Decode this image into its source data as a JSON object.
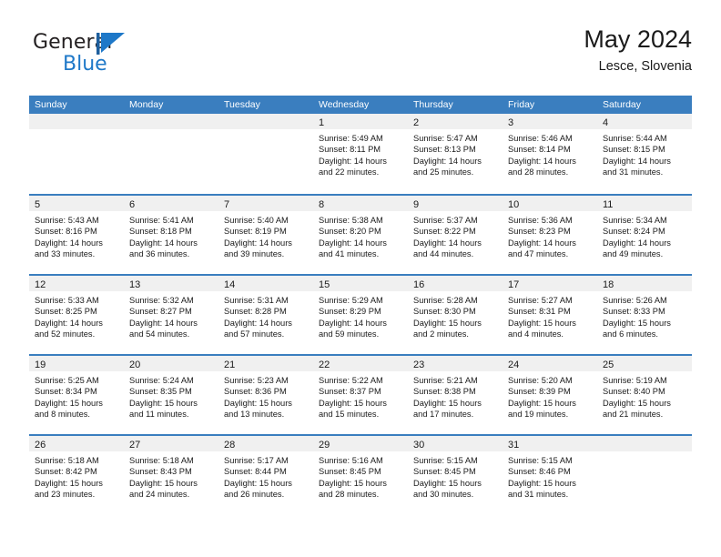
{
  "logo": {
    "word_one": "General",
    "word_two": "Blue",
    "mark": "triangle-pennant-icon",
    "accent_color": "#1e78c8"
  },
  "header": {
    "title": "May 2024",
    "subtitle": "Lesce, Slovenia"
  },
  "calendar": {
    "header_bg": "#3a7ebf",
    "daynum_band_bg": "#f0f0f0",
    "weekday_headers": [
      "Sunday",
      "Monday",
      "Tuesday",
      "Wednesday",
      "Thursday",
      "Friday",
      "Saturday"
    ],
    "weeks": [
      [
        {
          "day": "",
          "empty": true
        },
        {
          "day": "",
          "empty": true
        },
        {
          "day": "",
          "empty": true
        },
        {
          "day": "1",
          "sunrise": "Sunrise: 5:49 AM",
          "sunset": "Sunset: 8:11 PM",
          "daylight_line1": "Daylight: 14 hours",
          "daylight_line2": "and 22 minutes."
        },
        {
          "day": "2",
          "sunrise": "Sunrise: 5:47 AM",
          "sunset": "Sunset: 8:13 PM",
          "daylight_line1": "Daylight: 14 hours",
          "daylight_line2": "and 25 minutes."
        },
        {
          "day": "3",
          "sunrise": "Sunrise: 5:46 AM",
          "sunset": "Sunset: 8:14 PM",
          "daylight_line1": "Daylight: 14 hours",
          "daylight_line2": "and 28 minutes."
        },
        {
          "day": "4",
          "sunrise": "Sunrise: 5:44 AM",
          "sunset": "Sunset: 8:15 PM",
          "daylight_line1": "Daylight: 14 hours",
          "daylight_line2": "and 31 minutes."
        }
      ],
      [
        {
          "day": "5",
          "sunrise": "Sunrise: 5:43 AM",
          "sunset": "Sunset: 8:16 PM",
          "daylight_line1": "Daylight: 14 hours",
          "daylight_line2": "and 33 minutes."
        },
        {
          "day": "6",
          "sunrise": "Sunrise: 5:41 AM",
          "sunset": "Sunset: 8:18 PM",
          "daylight_line1": "Daylight: 14 hours",
          "daylight_line2": "and 36 minutes."
        },
        {
          "day": "7",
          "sunrise": "Sunrise: 5:40 AM",
          "sunset": "Sunset: 8:19 PM",
          "daylight_line1": "Daylight: 14 hours",
          "daylight_line2": "and 39 minutes."
        },
        {
          "day": "8",
          "sunrise": "Sunrise: 5:38 AM",
          "sunset": "Sunset: 8:20 PM",
          "daylight_line1": "Daylight: 14 hours",
          "daylight_line2": "and 41 minutes."
        },
        {
          "day": "9",
          "sunrise": "Sunrise: 5:37 AM",
          "sunset": "Sunset: 8:22 PM",
          "daylight_line1": "Daylight: 14 hours",
          "daylight_line2": "and 44 minutes."
        },
        {
          "day": "10",
          "sunrise": "Sunrise: 5:36 AM",
          "sunset": "Sunset: 8:23 PM",
          "daylight_line1": "Daylight: 14 hours",
          "daylight_line2": "and 47 minutes."
        },
        {
          "day": "11",
          "sunrise": "Sunrise: 5:34 AM",
          "sunset": "Sunset: 8:24 PM",
          "daylight_line1": "Daylight: 14 hours",
          "daylight_line2": "and 49 minutes."
        }
      ],
      [
        {
          "day": "12",
          "sunrise": "Sunrise: 5:33 AM",
          "sunset": "Sunset: 8:25 PM",
          "daylight_line1": "Daylight: 14 hours",
          "daylight_line2": "and 52 minutes."
        },
        {
          "day": "13",
          "sunrise": "Sunrise: 5:32 AM",
          "sunset": "Sunset: 8:27 PM",
          "daylight_line1": "Daylight: 14 hours",
          "daylight_line2": "and 54 minutes."
        },
        {
          "day": "14",
          "sunrise": "Sunrise: 5:31 AM",
          "sunset": "Sunset: 8:28 PM",
          "daylight_line1": "Daylight: 14 hours",
          "daylight_line2": "and 57 minutes."
        },
        {
          "day": "15",
          "sunrise": "Sunrise: 5:29 AM",
          "sunset": "Sunset: 8:29 PM",
          "daylight_line1": "Daylight: 14 hours",
          "daylight_line2": "and 59 minutes."
        },
        {
          "day": "16",
          "sunrise": "Sunrise: 5:28 AM",
          "sunset": "Sunset: 8:30 PM",
          "daylight_line1": "Daylight: 15 hours",
          "daylight_line2": "and 2 minutes."
        },
        {
          "day": "17",
          "sunrise": "Sunrise: 5:27 AM",
          "sunset": "Sunset: 8:31 PM",
          "daylight_line1": "Daylight: 15 hours",
          "daylight_line2": "and 4 minutes."
        },
        {
          "day": "18",
          "sunrise": "Sunrise: 5:26 AM",
          "sunset": "Sunset: 8:33 PM",
          "daylight_line1": "Daylight: 15 hours",
          "daylight_line2": "and 6 minutes."
        }
      ],
      [
        {
          "day": "19",
          "sunrise": "Sunrise: 5:25 AM",
          "sunset": "Sunset: 8:34 PM",
          "daylight_line1": "Daylight: 15 hours",
          "daylight_line2": "and 8 minutes."
        },
        {
          "day": "20",
          "sunrise": "Sunrise: 5:24 AM",
          "sunset": "Sunset: 8:35 PM",
          "daylight_line1": "Daylight: 15 hours",
          "daylight_line2": "and 11 minutes."
        },
        {
          "day": "21",
          "sunrise": "Sunrise: 5:23 AM",
          "sunset": "Sunset: 8:36 PM",
          "daylight_line1": "Daylight: 15 hours",
          "daylight_line2": "and 13 minutes."
        },
        {
          "day": "22",
          "sunrise": "Sunrise: 5:22 AM",
          "sunset": "Sunset: 8:37 PM",
          "daylight_line1": "Daylight: 15 hours",
          "daylight_line2": "and 15 minutes."
        },
        {
          "day": "23",
          "sunrise": "Sunrise: 5:21 AM",
          "sunset": "Sunset: 8:38 PM",
          "daylight_line1": "Daylight: 15 hours",
          "daylight_line2": "and 17 minutes."
        },
        {
          "day": "24",
          "sunrise": "Sunrise: 5:20 AM",
          "sunset": "Sunset: 8:39 PM",
          "daylight_line1": "Daylight: 15 hours",
          "daylight_line2": "and 19 minutes."
        },
        {
          "day": "25",
          "sunrise": "Sunrise: 5:19 AM",
          "sunset": "Sunset: 8:40 PM",
          "daylight_line1": "Daylight: 15 hours",
          "daylight_line2": "and 21 minutes."
        }
      ],
      [
        {
          "day": "26",
          "sunrise": "Sunrise: 5:18 AM",
          "sunset": "Sunset: 8:42 PM",
          "daylight_line1": "Daylight: 15 hours",
          "daylight_line2": "and 23 minutes."
        },
        {
          "day": "27",
          "sunrise": "Sunrise: 5:18 AM",
          "sunset": "Sunset: 8:43 PM",
          "daylight_line1": "Daylight: 15 hours",
          "daylight_line2": "and 24 minutes."
        },
        {
          "day": "28",
          "sunrise": "Sunrise: 5:17 AM",
          "sunset": "Sunset: 8:44 PM",
          "daylight_line1": "Daylight: 15 hours",
          "daylight_line2": "and 26 minutes."
        },
        {
          "day": "29",
          "sunrise": "Sunrise: 5:16 AM",
          "sunset": "Sunset: 8:45 PM",
          "daylight_line1": "Daylight: 15 hours",
          "daylight_line2": "and 28 minutes."
        },
        {
          "day": "30",
          "sunrise": "Sunrise: 5:15 AM",
          "sunset": "Sunset: 8:45 PM",
          "daylight_line1": "Daylight: 15 hours",
          "daylight_line2": "and 30 minutes."
        },
        {
          "day": "31",
          "sunrise": "Sunrise: 5:15 AM",
          "sunset": "Sunset: 8:46 PM",
          "daylight_line1": "Daylight: 15 hours",
          "daylight_line2": "and 31 minutes."
        },
        {
          "day": "",
          "empty": true
        }
      ]
    ]
  }
}
